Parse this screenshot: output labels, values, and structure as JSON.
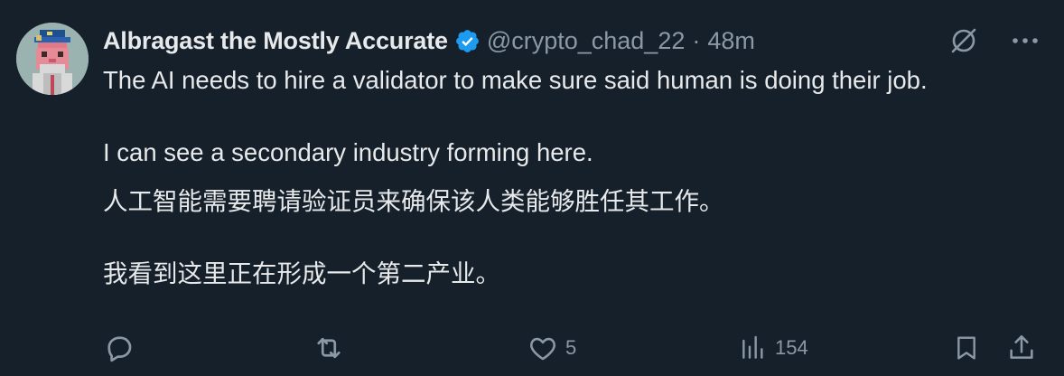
{
  "tweet": {
    "author_name": "Albragast the Mostly Accurate",
    "handle": "@crypto_chad_22",
    "separator": "·",
    "time": "48m",
    "paragraphs": [
      "The AI needs to hire a validator to make sure said human is doing their job.",
      "I can see a secondary industry forming here.",
      "人工智能需要聘请验证员来确保该人类能够胜任其工作。",
      "我看到这里正在形成一个第二产业。"
    ],
    "actions": {
      "reply_count": "",
      "repost_count": "",
      "like_count": "5",
      "views_count": "154"
    },
    "icons": {
      "grok": "grok-slash-icon",
      "more": "more-dots-icon",
      "verified": "verified-badge-icon",
      "reply": "reply-icon",
      "repost": "repost-icon",
      "like": "heart-icon",
      "views": "views-icon",
      "bookmark": "bookmark-icon",
      "share": "share-icon"
    },
    "colors": {
      "background": "#15202b",
      "text": "#e7e9ea",
      "muted": "#8b98a5",
      "verified": "#1d9bf0"
    }
  }
}
